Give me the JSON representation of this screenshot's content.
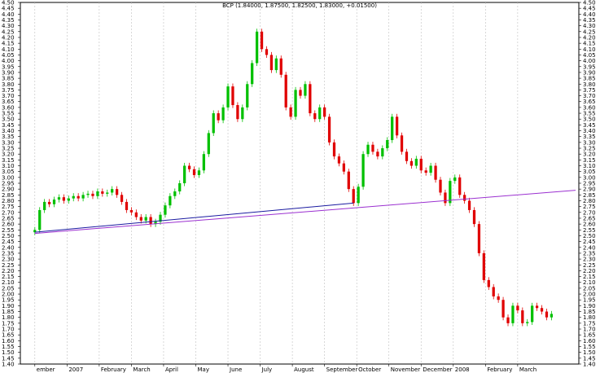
{
  "chart_data": {
    "type": "candlestick",
    "title": "BCP (1.84000, 1.87500, 1.82500, 1.83000, +0.01500)",
    "xlabel": "",
    "ylabel": "",
    "ylim": [
      1.4,
      4.5
    ],
    "y_ticks": [
      1.4,
      1.45,
      1.5,
      1.55,
      1.6,
      1.65,
      1.7,
      1.75,
      1.8,
      1.85,
      1.9,
      1.95,
      2.0,
      2.05,
      2.1,
      2.15,
      2.2,
      2.25,
      2.3,
      2.35,
      2.4,
      2.45,
      2.5,
      2.55,
      2.6,
      2.65,
      2.7,
      2.75,
      2.8,
      2.85,
      2.9,
      2.95,
      3.0,
      3.05,
      3.1,
      3.15,
      3.2,
      3.25,
      3.3,
      3.35,
      3.4,
      3.45,
      3.5,
      3.55,
      3.6,
      3.65,
      3.7,
      3.75,
      3.8,
      3.85,
      3.9,
      3.95,
      4.0,
      4.05,
      4.1,
      4.15,
      4.2,
      4.25,
      4.3,
      4.35,
      4.4,
      4.45,
      4.5
    ],
    "x_ticks": [
      "ember",
      "2007",
      "February",
      "March",
      "April",
      "May",
      "June",
      "July",
      "August",
      "September",
      "October",
      "November",
      "December",
      "2008",
      "February",
      "March"
    ],
    "x_tick_positions": [
      0,
      1,
      2,
      3,
      4,
      5,
      6,
      7,
      8,
      9,
      10,
      11,
      12,
      13,
      14,
      15
    ],
    "grid": true,
    "legend": "none",
    "colors": {
      "up": "#00c000",
      "down": "#e00000",
      "trend_primary": "#1a1aa0",
      "trend_secondary": "#9b30d0",
      "grid": "#bfbfbf"
    },
    "close_series": [
      [
        0.0,
        2.55
      ],
      [
        0.15,
        2.72
      ],
      [
        0.3,
        2.79
      ],
      [
        0.45,
        2.77
      ],
      [
        0.6,
        2.81
      ],
      [
        0.75,
        2.83
      ],
      [
        0.9,
        2.8
      ],
      [
        1.05,
        2.82
      ],
      [
        1.2,
        2.84
      ],
      [
        1.35,
        2.82
      ],
      [
        1.5,
        2.85
      ],
      [
        1.65,
        2.86
      ],
      [
        1.8,
        2.84
      ],
      [
        1.95,
        2.88
      ],
      [
        2.1,
        2.86
      ],
      [
        2.25,
        2.87
      ],
      [
        2.4,
        2.9
      ],
      [
        2.55,
        2.85
      ],
      [
        2.7,
        2.79
      ],
      [
        2.85,
        2.72
      ],
      [
        3.0,
        2.7
      ],
      [
        3.15,
        2.66
      ],
      [
        3.3,
        2.63
      ],
      [
        3.45,
        2.66
      ],
      [
        3.6,
        2.6
      ],
      [
        3.75,
        2.62
      ],
      [
        3.9,
        2.68
      ],
      [
        4.05,
        2.76
      ],
      [
        4.2,
        2.84
      ],
      [
        4.35,
        2.88
      ],
      [
        4.5,
        2.95
      ],
      [
        4.65,
        3.1
      ],
      [
        4.8,
        3.07
      ],
      [
        4.95,
        3.02
      ],
      [
        5.1,
        3.06
      ],
      [
        5.25,
        3.2
      ],
      [
        5.4,
        3.38
      ],
      [
        5.55,
        3.55
      ],
      [
        5.7,
        3.49
      ],
      [
        5.85,
        3.6
      ],
      [
        6.0,
        3.78
      ],
      [
        6.15,
        3.62
      ],
      [
        6.3,
        3.5
      ],
      [
        6.45,
        3.6
      ],
      [
        6.6,
        3.8
      ],
      [
        6.75,
        3.98
      ],
      [
        6.9,
        4.25
      ],
      [
        7.05,
        4.1
      ],
      [
        7.2,
        4.05
      ],
      [
        7.35,
        3.92
      ],
      [
        7.5,
        4.02
      ],
      [
        7.65,
        3.88
      ],
      [
        7.8,
        3.6
      ],
      [
        7.95,
        3.52
      ],
      [
        8.1,
        3.75
      ],
      [
        8.25,
        3.7
      ],
      [
        8.4,
        3.8
      ],
      [
        8.55,
        3.55
      ],
      [
        8.7,
        3.5
      ],
      [
        8.85,
        3.6
      ],
      [
        9.0,
        3.52
      ],
      [
        9.15,
        3.3
      ],
      [
        9.3,
        3.18
      ],
      [
        9.45,
        3.12
      ],
      [
        9.6,
        3.05
      ],
      [
        9.75,
        2.9
      ],
      [
        9.9,
        2.78
      ],
      [
        10.05,
        2.92
      ],
      [
        10.2,
        3.2
      ],
      [
        10.35,
        3.28
      ],
      [
        10.5,
        3.22
      ],
      [
        10.65,
        3.18
      ],
      [
        10.8,
        3.25
      ],
      [
        10.95,
        3.32
      ],
      [
        11.1,
        3.52
      ],
      [
        11.25,
        3.36
      ],
      [
        11.4,
        3.22
      ],
      [
        11.55,
        3.14
      ],
      [
        11.7,
        3.1
      ],
      [
        11.85,
        3.16
      ],
      [
        12.0,
        3.06
      ],
      [
        12.15,
        3.04
      ],
      [
        12.3,
        3.1
      ],
      [
        12.45,
        2.98
      ],
      [
        12.6,
        2.87
      ],
      [
        12.75,
        2.78
      ],
      [
        12.9,
        2.97
      ],
      [
        13.05,
        3.0
      ],
      [
        13.2,
        2.85
      ],
      [
        13.35,
        2.8
      ],
      [
        13.5,
        2.72
      ],
      [
        13.65,
        2.6
      ],
      [
        13.8,
        2.35
      ],
      [
        13.95,
        2.12
      ],
      [
        14.1,
        2.06
      ],
      [
        14.25,
        1.98
      ],
      [
        14.4,
        1.95
      ],
      [
        14.55,
        1.8
      ],
      [
        14.7,
        1.75
      ],
      [
        14.85,
        1.9
      ],
      [
        15.0,
        1.86
      ],
      [
        15.15,
        1.75
      ],
      [
        15.3,
        1.76
      ],
      [
        15.45,
        1.9
      ],
      [
        15.6,
        1.88
      ],
      [
        15.75,
        1.85
      ],
      [
        15.9,
        1.8
      ],
      [
        16.05,
        1.83
      ]
    ],
    "trendlines": [
      {
        "name": "",
        "points": [
          [
            0.0,
            2.53
          ],
          [
            9.9,
            2.78
          ]
        ]
      },
      {
        "name": "",
        "points": [
          [
            0.0,
            2.52
          ],
          [
            16.8,
            2.89
          ]
        ]
      }
    ]
  }
}
